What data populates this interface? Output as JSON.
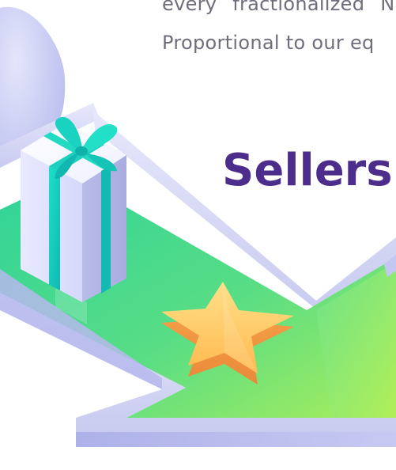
{
  "body_text": {
    "line_1": "every fractionalized N",
    "line_2": "Proportional to our eq"
  },
  "heading": "Sellers",
  "illustration": {
    "objects": [
      "gift-box",
      "ribbon-bow",
      "star",
      "arrow-platform",
      "dome"
    ],
    "colors": {
      "heading": "#4d2d8c",
      "body_text": "#6e6e7c",
      "platform_green": "#52dd8e",
      "platform_lime": "#a9ef5a",
      "frame_lavender": "#d3d4f4",
      "gift_white": "#f5f6ff",
      "ribbon_teal": "#1cd6c0",
      "star_gold": "#ffc85c"
    }
  }
}
